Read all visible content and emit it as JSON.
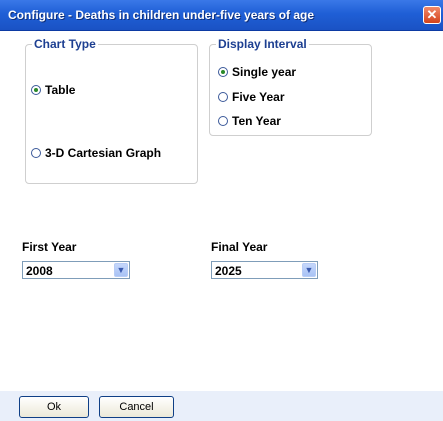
{
  "window": {
    "title": "Configure - Deaths in children under-five years of age",
    "close_symbol": "✕"
  },
  "chart_type": {
    "legend": "Chart Type",
    "options": [
      {
        "label": "Table",
        "selected": true
      },
      {
        "label": "3-D Cartesian Graph",
        "selected": false
      }
    ]
  },
  "display_interval": {
    "legend": "Display Interval",
    "options": [
      {
        "label": "Single year",
        "selected": true
      },
      {
        "label": "Five Year",
        "selected": false
      },
      {
        "label": "Ten Year",
        "selected": false
      }
    ]
  },
  "first_year": {
    "label": "First Year",
    "value": "2008"
  },
  "final_year": {
    "label": "Final Year",
    "value": "2025"
  },
  "buttons": {
    "ok": "Ok",
    "cancel": "Cancel"
  }
}
